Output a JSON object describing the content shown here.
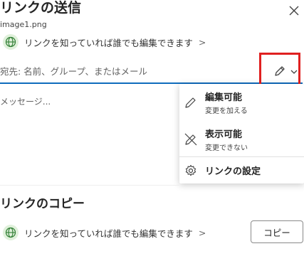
{
  "dialog": {
    "title": "リンクの送信",
    "filename": "image1.png",
    "close_icon": "close-icon"
  },
  "share_link": {
    "permission_text": "リンクを知っていれば誰でも編集できます",
    "chevron": ">"
  },
  "recipients": {
    "placeholder": "宛先: 名前、グループ、またはメール"
  },
  "message": {
    "placeholder": "メッセージ..."
  },
  "permission_menu": {
    "items": [
      {
        "title": "編集可能",
        "subtitle": "変更を加える",
        "icon": "pencil-icon"
      },
      {
        "title": "表示可能",
        "subtitle": "変更できない",
        "icon": "pencil-off-icon"
      }
    ],
    "settings_label": "リンクの設定",
    "settings_icon": "gear-icon"
  },
  "copy_section": {
    "title": "リンクのコピー",
    "permission_text": "リンクを知っていれば誰でも編集できます",
    "chevron": ">",
    "copy_button": "コピー"
  },
  "colors": {
    "accent": "#0f6cbd",
    "highlight": "#e02020",
    "globe_bg": "#dff0da",
    "globe_fg": "#2e7d32"
  }
}
